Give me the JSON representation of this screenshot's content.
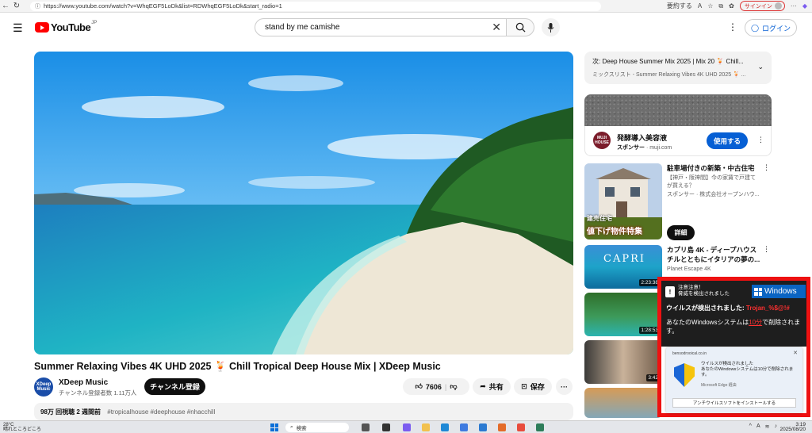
{
  "browser": {
    "url": "https://www.youtube.com/watch?v=WhqEGF5LoDk&list=RDWhqEGF5LoDk&start_radio=1",
    "summary_label": "要約する",
    "signin_label": "サインイン"
  },
  "header": {
    "logo_text": "YouTube",
    "logo_region": "JP",
    "search_value": "stand by me camishe",
    "login_label": "ログイン"
  },
  "video": {
    "title": "Summer Relaxing Vibes 4K UHD 2025 🍹 Chill Tropical Deep House Mix | XDeep Music",
    "channel_name": "XDeep Music",
    "channel_avatar_text": "XDeep Music",
    "subscribers": "チャンネル登録者数 1.11万人",
    "subscribe_label": "チャンネル登録",
    "likes": "7606",
    "share_label": "共有",
    "save_label": "保存",
    "views_date": "98万 回視聴  2 週間前",
    "hashtags": "#tropicalhouse #deephouse #nhacchill"
  },
  "sidebar": {
    "mix": {
      "title": "次: Deep House Summer Mix 2025 | Mix 20 🍹 Chill...",
      "subtitle": "ミックスリスト - Summer Relaxing Vibes 4K UHD 2025 🍹 ..."
    },
    "ad": {
      "logo_text": "MUJI HOUSE",
      "title": "発酵導入美容液",
      "sponsor_label": "スポンサー",
      "sponsor_domain": "· muji.com",
      "cta": "使用する"
    },
    "recs": [
      {
        "title": "駐車場付きの新築・中古住宅",
        "desc": "【神戸・阪神間】今の家賃で戸建てが買える？",
        "meta": "スポンサー · 株式会社オープンハウ...",
        "thumb_text": "値下げ物件特集",
        "thumb_text2": "建売住宅",
        "cta": "詳細"
      },
      {
        "title": "カプリ島 4K - ディープハウスチルとともにイタリアの夢の...",
        "meta": "Planet Escape 4K",
        "meta2": "",
        "duration": "2:23:38",
        "thumb_text": "CAPRI"
      },
      {
        "title": "",
        "meta": "",
        "duration": "1:28:53"
      },
      {
        "title": "",
        "meta": "",
        "duration": "3:42"
      },
      {
        "title": "",
        "meta": "",
        "duration": ""
      }
    ]
  },
  "scam_popup": {
    "header_line1": "注意注意！",
    "header_line2": "脅威を検出されました",
    "windows_label": "Windows",
    "virus_label": "ウイルスが検出されました:",
    "virus_name": "Trojan_%$@!#",
    "message_before": "あなたのWindowsシステムは",
    "message_highlight": "10分",
    "message_after": "で削除されます。",
    "notif_domain": "bensodrooical.co.in",
    "notif_line1": "ウイルスが検出されました",
    "notif_line2": "あなたのWindowsシステムは10分で削除されます。",
    "notif_source": "Microsoft Edge 経由",
    "notif_button": "アンチウイルスソフトをインストールする"
  },
  "taskbar": {
    "temp": "28°C",
    "weather": "晴れところどころ",
    "search_label": "検索",
    "time": "3:19",
    "date": "2025/08/20",
    "ime": "A"
  }
}
